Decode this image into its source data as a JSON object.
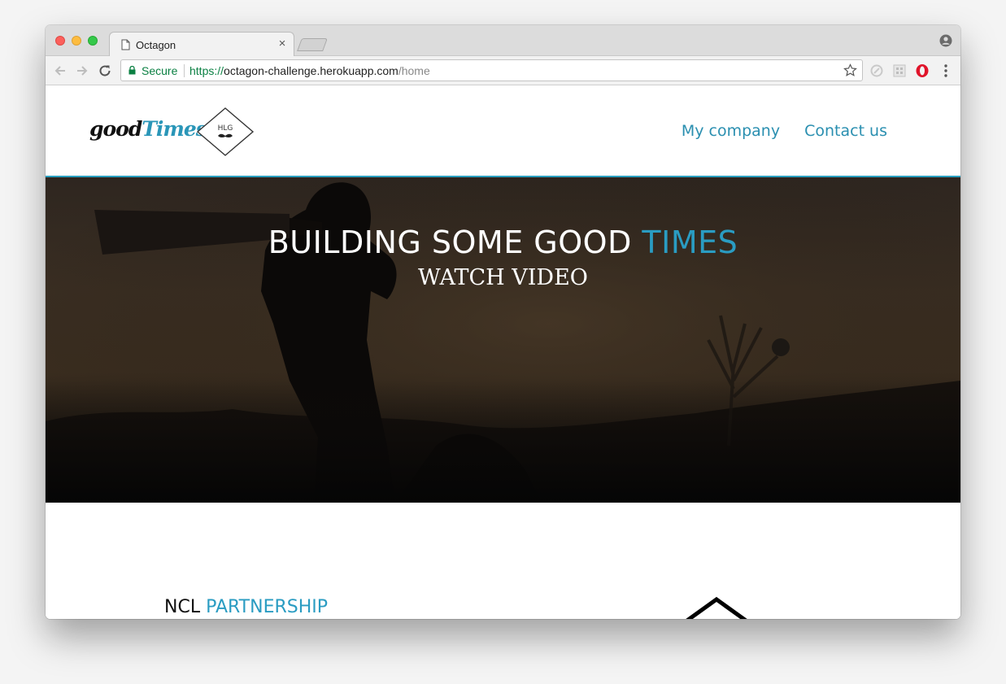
{
  "browser": {
    "tab_title": "Octagon",
    "close_glyph": "×",
    "secure_label": "Secure",
    "url_scheme": "https://",
    "url_host": "octagon-challenge.herokuapp.com",
    "url_path": "/home"
  },
  "site": {
    "logo_good": "good",
    "logo_times": "Times",
    "badge_text": "HLG",
    "nav": {
      "my_company": "My company",
      "contact_us": "Contact us"
    }
  },
  "hero": {
    "title_main": "BUILDING SOME GOOD ",
    "title_accent": "TIMES",
    "cta": "WATCH VIDEO"
  },
  "section": {
    "heading_main": "NCL ",
    "heading_accent": "PARTNERSHIP"
  },
  "colors": {
    "accent": "#2a9cc2",
    "secure_green": "#0b8043"
  },
  "icons": [
    "page-icon",
    "close-icon",
    "profile-icon",
    "back-icon",
    "forward-icon",
    "reload-icon",
    "lock-icon",
    "star-icon",
    "extension-icon",
    "opera-icon",
    "menu-icon",
    "octagon-icon"
  ]
}
